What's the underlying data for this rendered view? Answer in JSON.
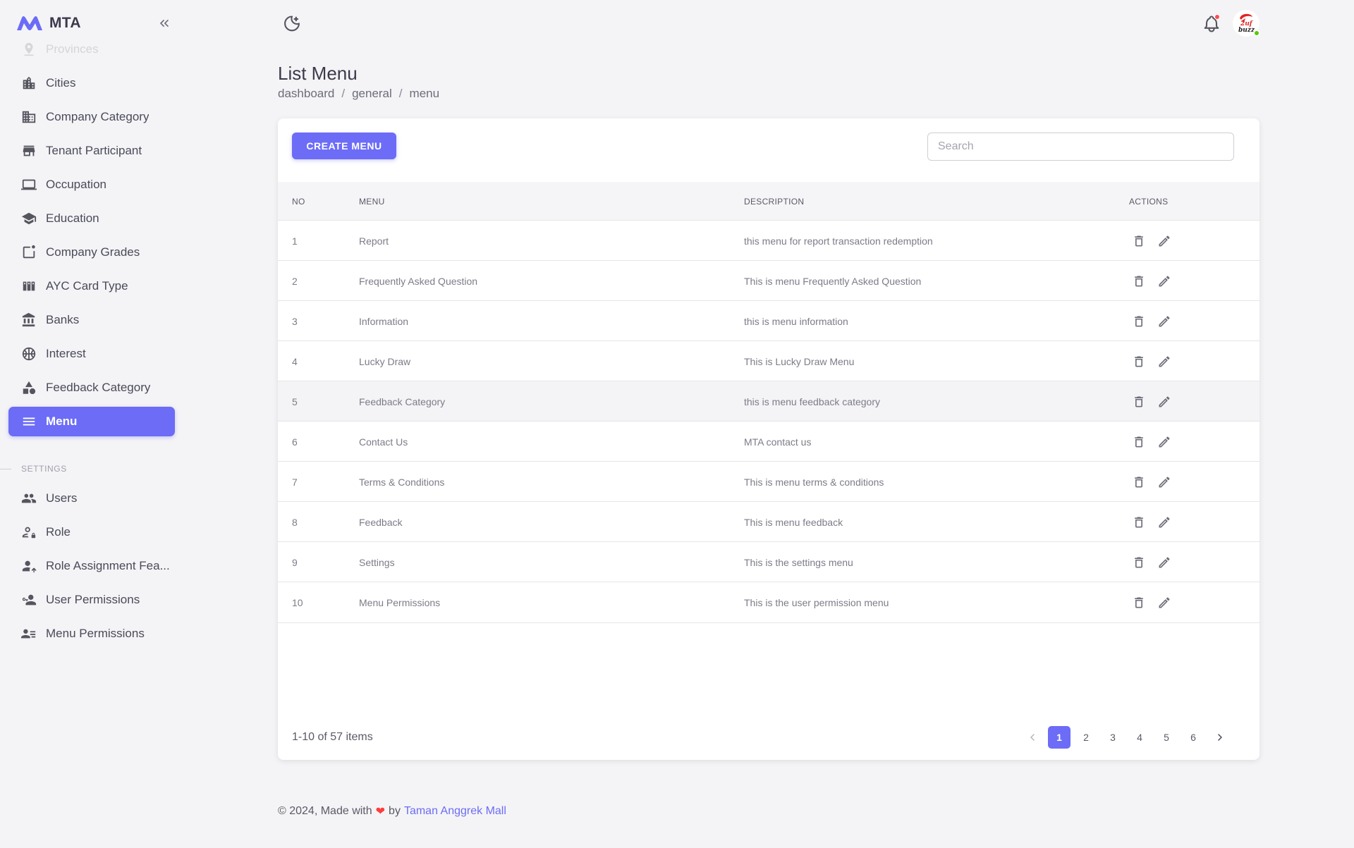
{
  "app": {
    "name": "MTA"
  },
  "sidebar": {
    "items": [
      {
        "label": "Provinces",
        "icon": "map-pin-icon",
        "faded": true
      },
      {
        "label": "Cities",
        "icon": "city-icon"
      },
      {
        "label": "Company Category",
        "icon": "office-building-icon"
      },
      {
        "label": "Tenant Participant",
        "icon": "storefront-icon"
      },
      {
        "label": "Occupation",
        "icon": "laptop-icon"
      },
      {
        "label": "Education",
        "icon": "graduation-cap-icon"
      },
      {
        "label": "Company Grades",
        "icon": "badge-square-icon"
      },
      {
        "label": "AYC Card Type",
        "icon": "card-columns-icon"
      },
      {
        "label": "Banks",
        "icon": "bank-icon"
      },
      {
        "label": "Interest",
        "icon": "basketball-icon"
      },
      {
        "label": "Feedback Category",
        "icon": "shapes-icon"
      },
      {
        "label": "Menu",
        "icon": "menu-lines-icon",
        "active": true
      }
    ],
    "settings_title": "SETTINGS",
    "settings_items": [
      {
        "label": "Users",
        "icon": "users-icon"
      },
      {
        "label": "Role",
        "icon": "user-lock-icon"
      },
      {
        "label": "Role Assignment Fea...",
        "icon": "user-assign-icon"
      },
      {
        "label": "User Permissions",
        "icon": "user-key-icon"
      },
      {
        "label": "Menu Permissions",
        "icon": "user-list-icon"
      }
    ]
  },
  "header": {
    "theme_toggle_icon": "moon-icon",
    "notifications_icon": "bell-icon",
    "notification_dot_color": "#ff4c51",
    "avatar_status_color": "#56ca00"
  },
  "page": {
    "title": "List Menu",
    "breadcrumb": [
      "dashboard",
      "general",
      "menu"
    ]
  },
  "toolbar": {
    "create_label": "CREATE MENU",
    "search_placeholder": "Search"
  },
  "table": {
    "columns": [
      "NO",
      "MENU",
      "DESCRIPTION",
      "ACTIONS"
    ],
    "rows": [
      {
        "no": "1",
        "menu": "Report",
        "description": "this menu for report transaction redemption"
      },
      {
        "no": "2",
        "menu": "Frequently Asked Question",
        "description": "This is menu Frequently Asked Question"
      },
      {
        "no": "3",
        "menu": "Information",
        "description": "this is menu information"
      },
      {
        "no": "4",
        "menu": "Lucky Draw",
        "description": "This is Lucky Draw Menu"
      },
      {
        "no": "5",
        "menu": "Feedback Category",
        "description": "this is menu feedback category"
      },
      {
        "no": "6",
        "menu": "Contact Us",
        "description": "MTA contact us"
      },
      {
        "no": "7",
        "menu": "Terms & Conditions",
        "description": "This is menu terms & conditions"
      },
      {
        "no": "8",
        "menu": "Feedback",
        "description": "This is menu feedback"
      },
      {
        "no": "9",
        "menu": "Settings",
        "description": "This is the settings menu"
      },
      {
        "no": "10",
        "menu": "Menu Permissions",
        "description": "This is the user permission menu"
      }
    ]
  },
  "pagination": {
    "summary": "1-10 of 57 items",
    "pages": [
      "1",
      "2",
      "3",
      "4",
      "5",
      "6"
    ],
    "current": "1"
  },
  "footer": {
    "prefix": "© 2024, Made with",
    "heart": "❤",
    "by": "by",
    "link_text": "Taman Anggrek Mall"
  },
  "colors": {
    "accent": "#6c6cf7",
    "background": "#f4f4f6"
  }
}
